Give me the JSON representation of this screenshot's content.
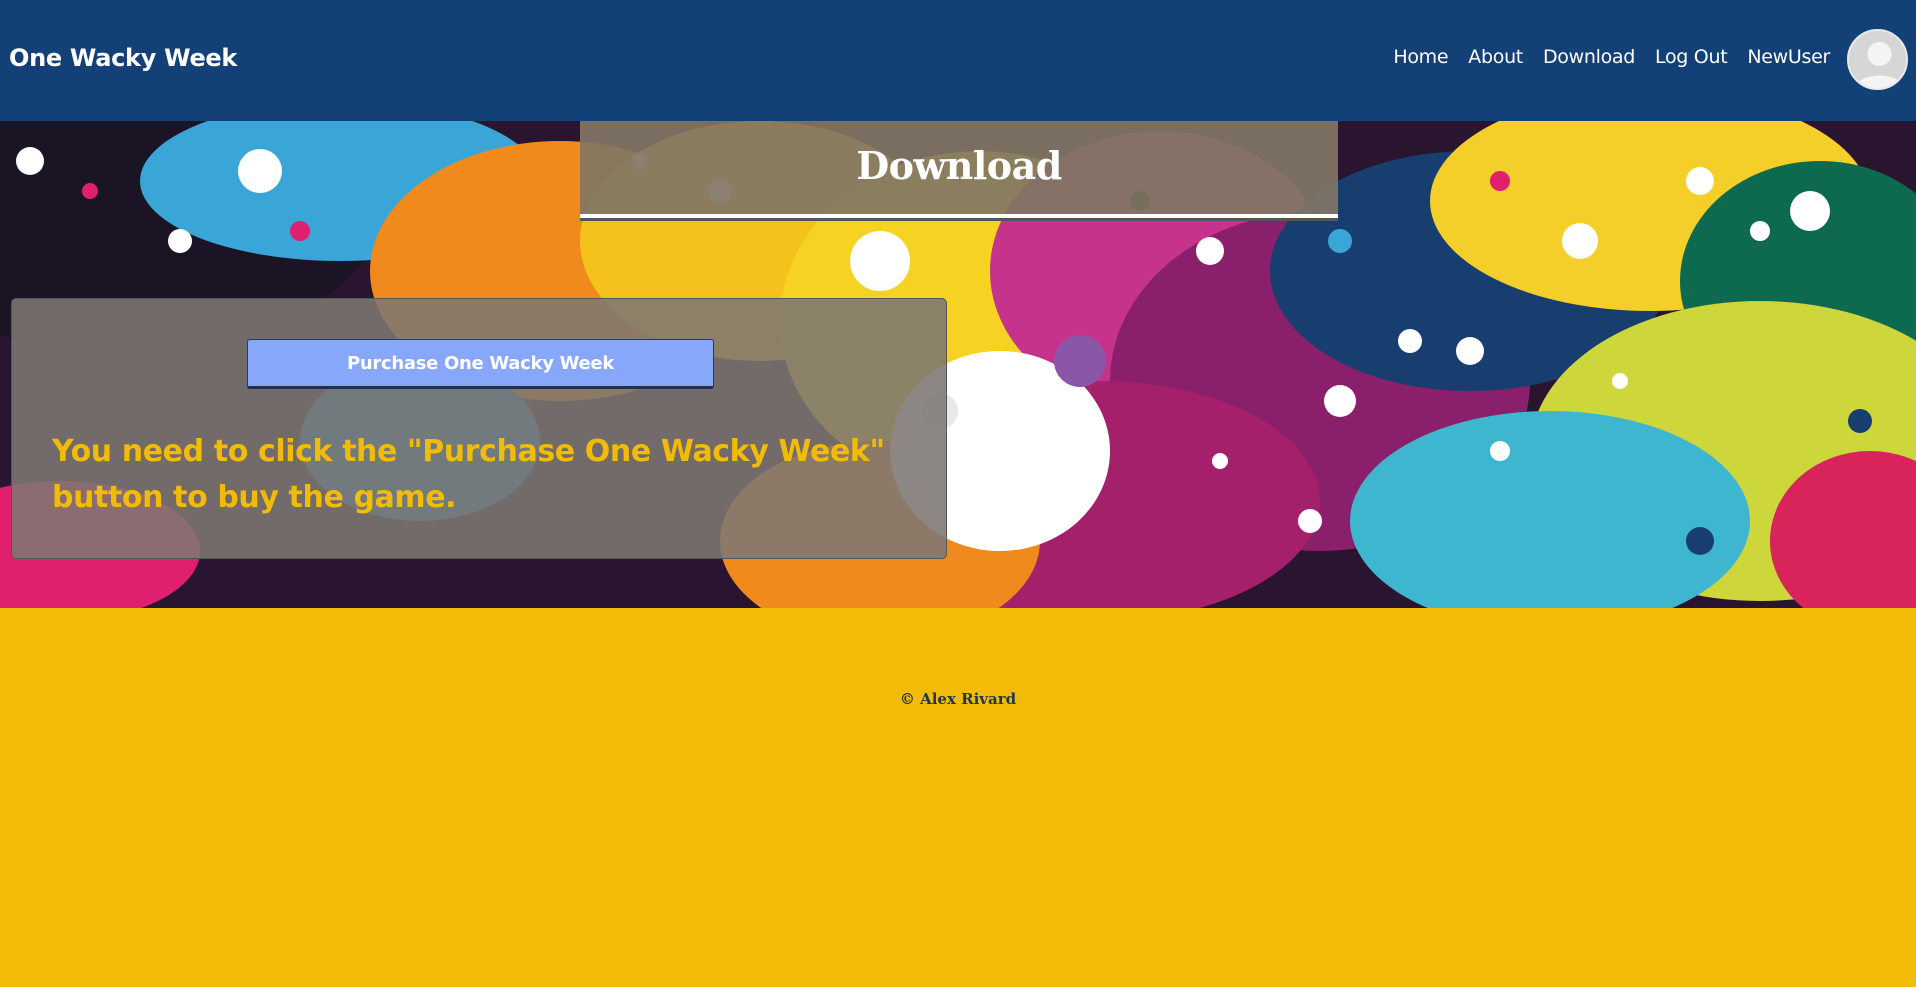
{
  "colors": {
    "navbar": "#144078",
    "accent_yellow": "#f2bb07",
    "button_blue": "#87a7fb",
    "footer_text": "#1d3556"
  },
  "header": {
    "brand": "One Wacky Week",
    "nav": [
      {
        "label": "Home"
      },
      {
        "label": "About"
      },
      {
        "label": "Download"
      },
      {
        "label": "Log Out"
      },
      {
        "label": "NewUser"
      }
    ],
    "avatar_icon": "user-avatar-icon"
  },
  "hero": {
    "background": "paint-splatter-image",
    "title": "Download",
    "purchase_button": "Purchase One Wacky Week",
    "notice": "You need to click the \"Purchase One Wacky Week\" button to buy the game."
  },
  "footer": {
    "copyright": "© Alex Rivard"
  }
}
